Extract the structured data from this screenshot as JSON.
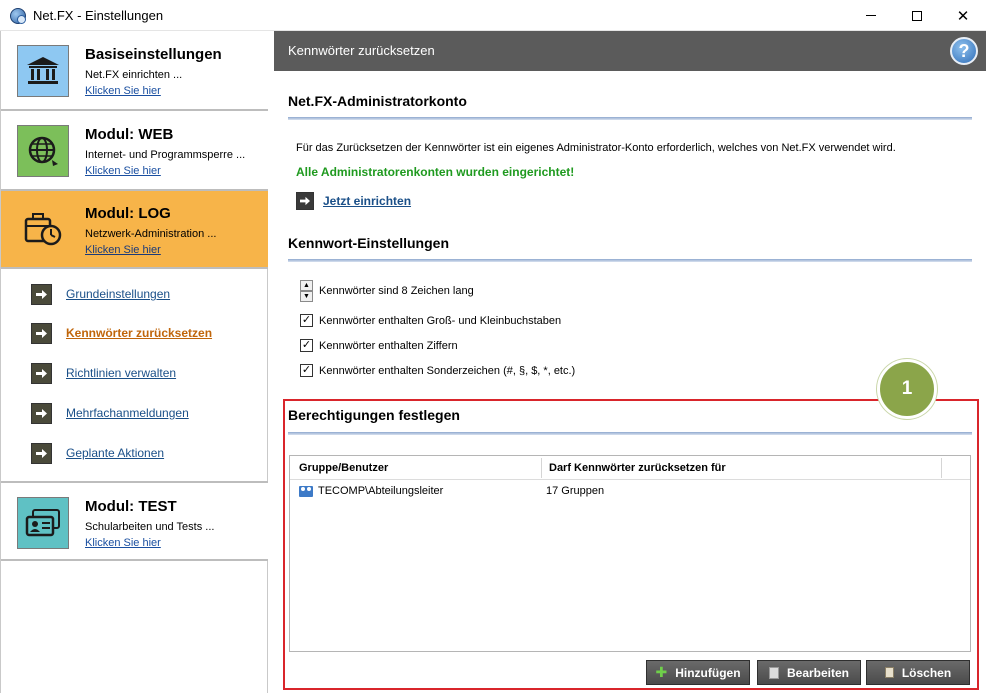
{
  "window": {
    "title": "Net.FX - Einstellungen"
  },
  "sidebar": {
    "modules": [
      {
        "title": "Basiseinstellungen",
        "subtitle": "Net.FX einrichten ...",
        "link": "Klicken Sie hier",
        "icon": "bank-icon"
      },
      {
        "title": "Modul: WEB",
        "subtitle": "Internet- und Programmsperre ...",
        "link": "Klicken Sie hier",
        "icon": "globe-icon"
      },
      {
        "title": "Modul: LOG",
        "subtitle": "Netzwerk-Administration ...",
        "link": "Klicken Sie hier",
        "icon": "briefcase-clock-icon"
      },
      {
        "title": "Modul: TEST",
        "subtitle": "Schularbeiten und Tests ...",
        "link": "Klicken Sie hier",
        "icon": "id-cards-icon"
      }
    ],
    "nav": [
      {
        "label": "Grundeinstellungen"
      },
      {
        "label": "Kennwörter zurücksetzen"
      },
      {
        "label": "Richtlinien verwalten"
      },
      {
        "label": "Mehrfachanmeldungen"
      },
      {
        "label": "Geplante Aktionen"
      }
    ],
    "active_accent": "#f7b449"
  },
  "main": {
    "header": "Kennwörter zurücksetzen",
    "help_label": "?",
    "admin": {
      "title": "Net.FX-Administratorkonto",
      "description": "Für das Zurücksetzen der Kennwörter ist ein eigenes Administrator-Konto erforderlich, welches von Net.FX verwendet wird.",
      "status": "Alle Administratorenkonten wurden eingerichtet!",
      "action": "Jetzt einrichten"
    },
    "password": {
      "title": "Kennwort-Einstellungen",
      "length_label": "Kennwörter sind 8 Zeichen lang",
      "options": [
        {
          "label": "Kennwörter enthalten Groß- und Kleinbuchstaben",
          "checked": true
        },
        {
          "label": "Kennwörter enthalten Ziffern",
          "checked": true
        },
        {
          "label": "Kennwörter enthalten Sonderzeichen (#, §, $, *, etc.)",
          "checked": true
        }
      ]
    },
    "permissions": {
      "title": "Berechtigungen festlegen",
      "badge": "1",
      "columns": [
        "Gruppe/Benutzer",
        "Darf Kennwörter zurücksetzen für"
      ],
      "rows": [
        {
          "user": "TECOMP\\Abteilungsleiter",
          "scope": "17 Gruppen"
        }
      ],
      "buttons": {
        "add": "Hinzufügen",
        "edit": "Bearbeiten",
        "delete": "Löschen"
      }
    }
  }
}
